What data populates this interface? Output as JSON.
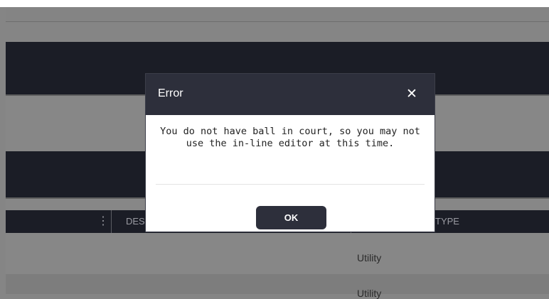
{
  "table": {
    "columns": {
      "menu_icon": "⋮",
      "description_partial": "DES",
      "type_partial": "TYPE"
    },
    "rows": [
      {
        "type": "Utility"
      },
      {
        "type": "Utility"
      }
    ]
  },
  "dialog": {
    "title": "Error",
    "close_icon": "✕",
    "message": "You do not have ball in court, so you may not use the in-line editor at this time.",
    "ok_label": "OK"
  },
  "colors": {
    "overlay_gray": "#858585",
    "dark_bar": "#1b1d26",
    "dialog_header": "#2d2f3b"
  }
}
